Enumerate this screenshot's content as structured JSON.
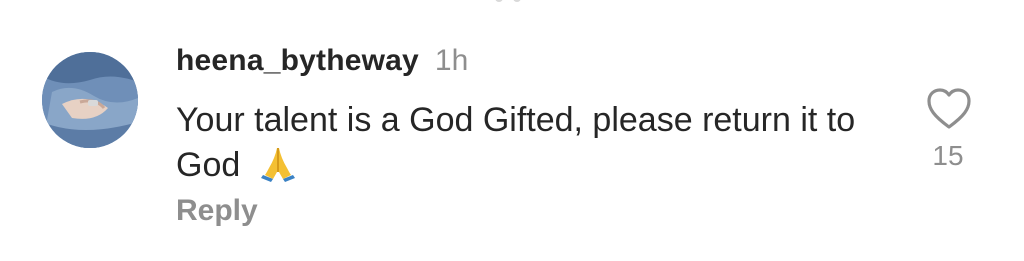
{
  "comment": {
    "username": "heena_bytheway",
    "time": "1h",
    "text": "Your talent is a God Gifted, please return it to God",
    "emoji": "folded-hands",
    "reply_label": "Reply",
    "like_count": "15"
  },
  "icons": {
    "like": "heart-icon",
    "emoji": "folded-hands-emoji"
  },
  "colors": {
    "text_primary": "#262626",
    "text_secondary": "#8e8e8e",
    "background": "#ffffff"
  }
}
